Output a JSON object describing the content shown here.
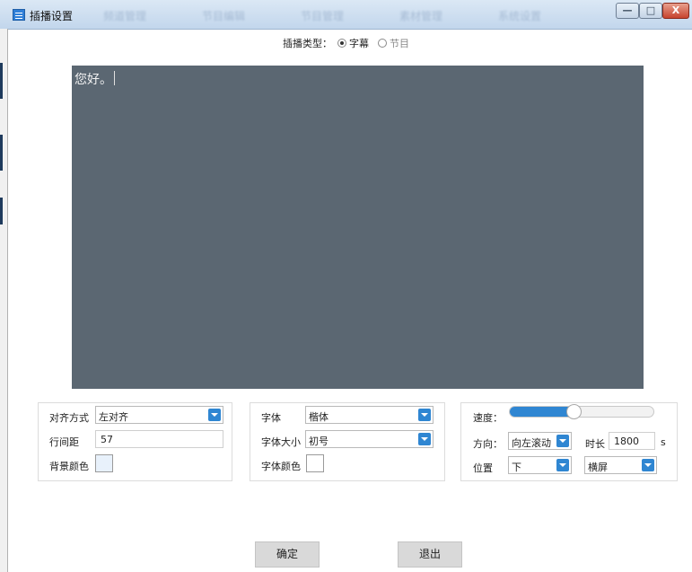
{
  "window": {
    "title": "插播设置",
    "background_menu": [
      "频道管理",
      "节目编辑",
      "节目管理",
      "素材管理",
      "系统设置"
    ],
    "controls": {
      "minimize": "—",
      "maximize": "□",
      "close": "X"
    }
  },
  "insert_type": {
    "label": "插播类型：",
    "options": [
      {
        "label": "字幕",
        "selected": true
      },
      {
        "label": "节目",
        "selected": false
      }
    ]
  },
  "editor": {
    "text": "您好。",
    "background": "#5b6772",
    "text_color": "#f2f2f2"
  },
  "panel_text": {
    "align": {
      "label": "对齐方式",
      "value": "左对齐"
    },
    "line_spacing": {
      "label": "行间距",
      "value": "57"
    },
    "bg_color": {
      "label": "背景颜色",
      "color": "#e8f1fb"
    }
  },
  "panel_font": {
    "font": {
      "label": "字体",
      "value": "楷体"
    },
    "size": {
      "label": "字体大小",
      "value": "初号"
    },
    "color": {
      "label": "字体颜色",
      "color": "#ffffff"
    }
  },
  "panel_motion": {
    "speed": {
      "label": "速度：",
      "level": 0.44
    },
    "direction": {
      "label": "方向：",
      "value": "向左滚动"
    },
    "duration": {
      "label": "时长",
      "value": "1800",
      "unit": "s"
    },
    "position": {
      "label": "位置",
      "value": "下"
    },
    "orientation": {
      "value": "横屏"
    }
  },
  "buttons": {
    "ok": "确定",
    "exit": "退出"
  },
  "accent_color": "#2f86d2"
}
